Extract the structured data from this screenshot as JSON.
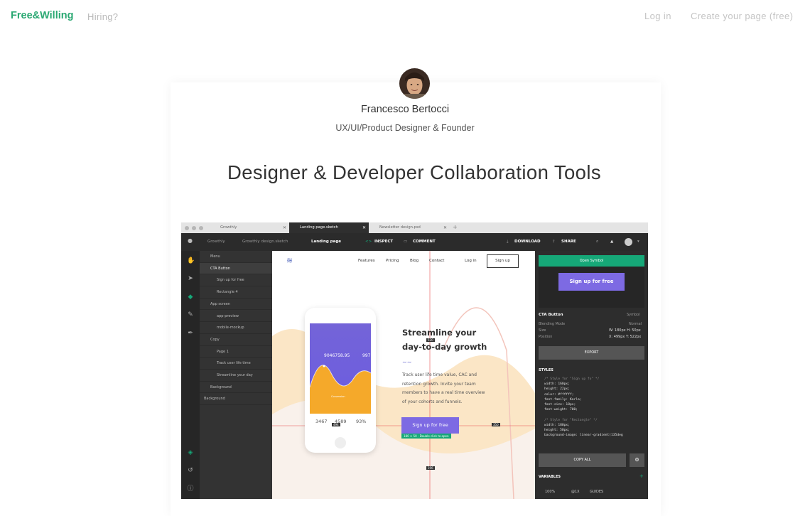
{
  "nav": {
    "brand": "Free&Willing",
    "hiring": "Hiring?",
    "login": "Log in",
    "create": "Create your page (free)"
  },
  "profile": {
    "name": "Francesco Bertocci",
    "role": "UX/UI/Product Designer & Founder"
  },
  "headline": "Designer & Developer Collaboration Tools",
  "app": {
    "tabs": [
      "Growthly",
      "Landing page.sketch",
      "Newsletter design.psd"
    ],
    "breadcrumb": [
      "Growthly",
      "Growthly design.sketch",
      "Landing page"
    ],
    "modes": {
      "inspect": "INSPECT",
      "comment": "COMMENT"
    },
    "actions": {
      "download": "DOWNLOAD",
      "share": "SHARE"
    },
    "layers": [
      {
        "label": "Menu",
        "indent": 1
      },
      {
        "label": "CTA Button",
        "indent": 1,
        "selected": true
      },
      {
        "label": "Sign up for free",
        "indent": 2
      },
      {
        "label": "Rectangle 4",
        "indent": 2
      },
      {
        "label": "App screen",
        "indent": 1
      },
      {
        "label": "app-preview",
        "indent": 2
      },
      {
        "label": "mobile-mockup",
        "indent": 2
      },
      {
        "label": "Copy",
        "indent": 1
      },
      {
        "label": "Page 1",
        "indent": 2
      },
      {
        "label": "Track user life time",
        "indent": 2
      },
      {
        "label": "Streamline your day",
        "indent": 2
      },
      {
        "label": "Background",
        "indent": 1
      },
      {
        "label": "Background",
        "indent": 0
      }
    ],
    "site": {
      "nav": [
        "Features",
        "Pricing",
        "Blog",
        "Contact"
      ],
      "login": "Log in",
      "signup": "Sign up",
      "heading_line1": "Streamline your",
      "heading_line2": "day-to-day growth",
      "body": [
        "Track user life time value, CAC and",
        "retention growth. Invite your team",
        "members to have a real time overview",
        "of your cohorts and funnels."
      ],
      "cta": "Sign up for free",
      "cta_hint": "180 × 50 - Double click to open",
      "phone_amount": "9046758.95",
      "phone_amount2": "997",
      "phone_stats": [
        "3467",
        "4589",
        "93%"
      ],
      "phone_caption": "Conversion",
      "measure_520": "520",
      "measure_494": "494",
      "measure_350": "350",
      "measure_196": "196"
    },
    "inspector": {
      "open_symbol": "Open Symbol",
      "preview_cta": "Sign up for free",
      "symbol_name": "CTA Button",
      "symbol_type": "Symbol",
      "blending": "Blending Mode",
      "blending_val": "Normal",
      "size": "Size",
      "size_val": "W: 180px  H: 50px",
      "position": "Position",
      "position_val": "X: 499px  Y: 522px",
      "export": "EXPORT",
      "styles": "STYLES",
      "code": [
        "/* Style for \"Sign up fo\" */",
        "width: 160px;",
        "height: 22px;",
        "color: #ffffff;",
        "font-family: Karla;",
        "font-size: 18px;",
        "font-weight: 700;",
        "",
        "/* Style for \"Rectangle\" */",
        "width: 180px;",
        "height: 50px;",
        "background-image: linear-gradient(135deg"
      ],
      "copy_all": "COPY ALL",
      "variables": "VARIABLES",
      "zoom": "100%",
      "scale": "@1X",
      "guides": "GUIDES"
    }
  },
  "colors": {
    "brand": "#2aa872",
    "accent_green": "#16a878",
    "purple": "#7d6ae3"
  }
}
